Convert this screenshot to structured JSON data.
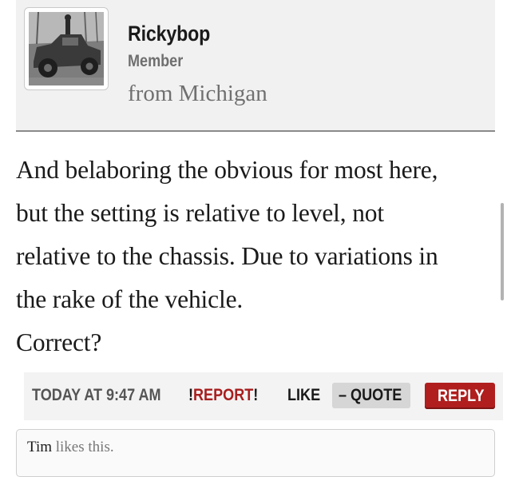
{
  "user": {
    "name": "Rickybop",
    "role": "Member",
    "location": "from Michigan"
  },
  "post": {
    "lines": [
      "And belaboring the obvious for most here,",
      "but the setting is relative to level, not",
      "relative to the chassis. Due to variations in",
      "the rake of the vehicle.",
      "Correct?"
    ]
  },
  "actions": {
    "timestamp": "TODAY AT 9:47 AM",
    "report_prefix": "!",
    "report_label": "REPORT",
    "report_suffix": "!",
    "like_label": "LIKE",
    "quote_label": "– QUOTE",
    "reply_label": "REPLY"
  },
  "likes": {
    "liker": "Tim",
    "suffix": " likes this."
  },
  "colors": {
    "accent_red": "#b01e1e",
    "header_bg": "#f1f1f1"
  }
}
